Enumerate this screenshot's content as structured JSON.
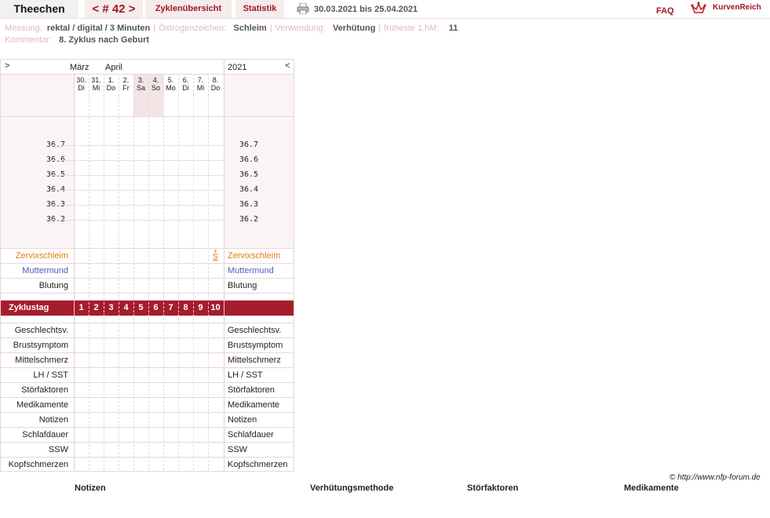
{
  "header": {
    "user": "Theechen",
    "nav_label": "< # 42 >",
    "tab_cycles": "Zyklenübersicht",
    "tab_stats": "Statistik",
    "date_from": "30.03.2021",
    "date_bis": "bis",
    "date_to": "25.04.2021",
    "faq": "FAQ",
    "brand": "KurvenReich"
  },
  "info": {
    "messung_label": "Messung:",
    "messung_value": "rektal / digital / 3 Minuten",
    "oestrogen_label": "Östrogenzeichen:",
    "oestrogen_value": "Schleim",
    "verwendung_label": "Verwendung:",
    "verwendung_value": "Verhütung",
    "fruehest_label": "früheste 1.hM:",
    "fruehest_value": "11",
    "kommentar_label": "Kommentar:",
    "kommentar_value": "8. Zyklus nach Geburt"
  },
  "chart": {
    "nav_left": ">",
    "nav_right": "<",
    "month_1": "März",
    "month_2": "April",
    "year": "2021",
    "days": [
      {
        "d": "30.",
        "w": "Di"
      },
      {
        "d": "31.",
        "w": "Mi"
      },
      {
        "d": "1.",
        "w": "Do"
      },
      {
        "d": "2.",
        "w": "Fr"
      },
      {
        "d": "3.",
        "w": "Sa"
      },
      {
        "d": "4.",
        "w": "So"
      },
      {
        "d": "5.",
        "w": "Mo"
      },
      {
        "d": "6.",
        "w": "Di"
      },
      {
        "d": "7.",
        "w": "Mi"
      },
      {
        "d": "8.",
        "w": "Do"
      }
    ],
    "temps": [
      "36.7",
      "36.6",
      "36.5",
      "36.4",
      "36.3",
      "36.2"
    ],
    "zervix_label": "Zervixschleim",
    "zervix_mark": "S+",
    "muttermund_label": "Muttermund",
    "blutung_label": "Blutung",
    "zyklustag_label": "Zyklustag",
    "cycle_days": [
      "1",
      "2",
      "3",
      "4",
      "5",
      "6",
      "7",
      "8",
      "9",
      "10"
    ],
    "bottom_rows": [
      "Geschlechtsv.",
      "Brustsymptom",
      "Mittelschmerz",
      "LH / SST",
      "Störfaktoren",
      "Medikamente",
      "Notizen",
      "Schlafdauer",
      "SSW",
      "Kopfschmerzen"
    ],
    "colors": {
      "accent": "#a51c2c",
      "zervix": "#e07b10",
      "muttermund": "#4d5fb8"
    }
  },
  "footer": {
    "copyright": "© http://www.nfp-forum.de",
    "col_notizen": "Notizen",
    "col_methode": "Verhütungsmethode",
    "col_stoer": "Störfaktoren",
    "col_medi": "Medikamente"
  }
}
